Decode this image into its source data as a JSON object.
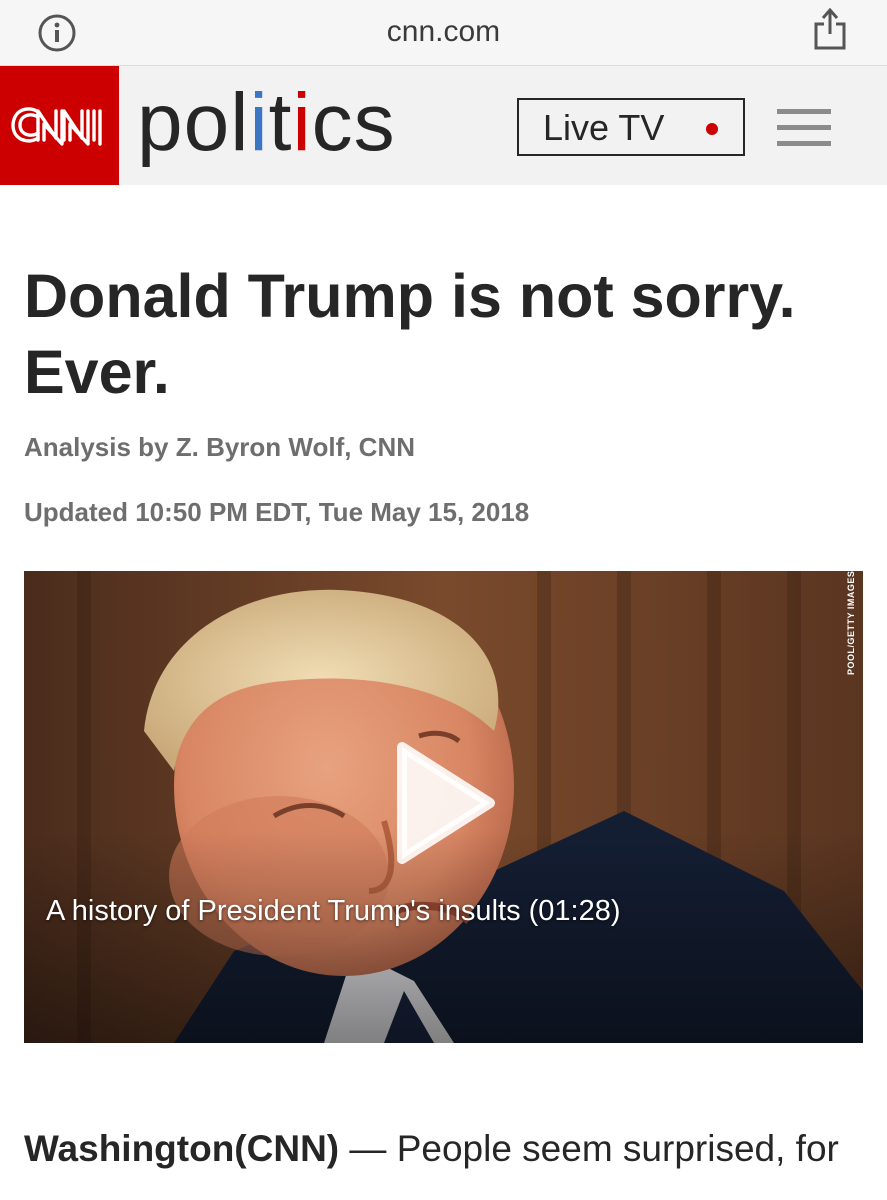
{
  "browser": {
    "url": "cnn.com",
    "info_icon": "info-circle-icon",
    "share_icon": "share-icon"
  },
  "header": {
    "logo_text": "CNN",
    "section_title": "politics",
    "live_tv_label": "Live TV",
    "menu_icon": "hamburger-menu-icon",
    "colors": {
      "brand_red": "#cc0000",
      "live_dot": "#cc0000"
    }
  },
  "article": {
    "headline": "Donald Trump is not sorry. Ever.",
    "byline": "Analysis by Z. Byron Wolf, CNN",
    "updated": "Updated 10:50 PM EDT, Tue May 15, 2018",
    "video": {
      "caption": "A history of President Trump's insults (01:28)",
      "photo_credit": "POOL/GETTY IMAGES",
      "play_icon": "play-icon"
    },
    "body_dateline": "Washington(CNN)",
    "body_dash": " — ",
    "body_text": "People seem surprised, for"
  }
}
